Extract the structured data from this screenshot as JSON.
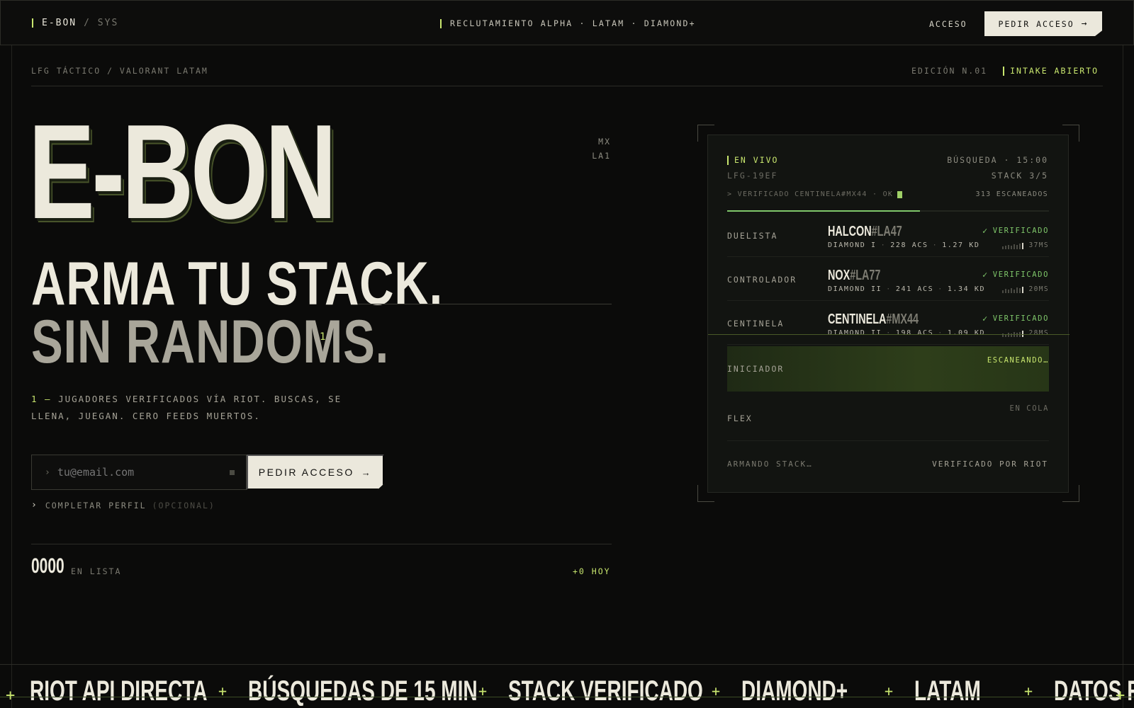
{
  "nav": {
    "brand": "E-BON",
    "brand_suffix": "/ SYS",
    "center": "RECLUTAMIENTO ALPHA · LATAM · DIAMOND+",
    "login": "ACCESO",
    "cta": "PEDIR ACCESO"
  },
  "subheader": {
    "left": "LFG TÁCTICO / VALORANT LATAM",
    "edition": "EDICIÓN N.01",
    "status": "INTAKE ABIERTO"
  },
  "hero": {
    "title": "E-BON",
    "regions": [
      "MX",
      "LA1"
    ],
    "headline_1": "ARMA TU STACK.",
    "headline_2": "SIN RANDOMS.",
    "footnote_mark": "1",
    "desc_prefix": "1 —",
    "desc": "JUGADORES VERIFICADOS VÍA RIOT. BUSCAS, SE LLENA, JUEGAN. CERO FEEDS MUERTOS."
  },
  "form": {
    "email_placeholder": "tu@email.com",
    "submit": "PEDIR ACCESO",
    "complete_profile": "COMPLETAR PERFIL",
    "optional": "(OPCIONAL)"
  },
  "stats": {
    "count": "0000",
    "count_label": "EN LISTA",
    "today": "+0 HOY"
  },
  "panel": {
    "live": "EN VIVO",
    "search": "BÚSQUEDA · 15:00",
    "id": "LFG-19EF",
    "stack": "STACK 3/5",
    "log": "> VERIFICADO CENTINELA#MX44 · OK",
    "scanned": "313 ESCANEADOS",
    "progress": 0.6,
    "slots": [
      {
        "role": "DUELISTA",
        "name": "HALCON",
        "tag": "#LA47",
        "rank": "DIAMOND I",
        "acs": "228 ACS",
        "kd": "1.27 KD",
        "status": "VERIFICADO",
        "ping": "37MS"
      },
      {
        "role": "CONTROLADOR",
        "name": "NOX",
        "tag": "#LA77",
        "rank": "DIAMOND II",
        "acs": "241 ACS",
        "kd": "1.34 KD",
        "status": "VERIFICADO",
        "ping": "20MS"
      },
      {
        "role": "CENTINELA",
        "name": "CENTINELA",
        "tag": "#MX44",
        "rank": "DIAMOND II",
        "acs": "198 ACS",
        "kd": "1.09 KD",
        "status": "VERIFICADO",
        "ping": "28MS"
      },
      {
        "role": "INICIADOR",
        "status": "ESCANEANDO…"
      },
      {
        "role": "FLEX",
        "status": "EN COLA"
      }
    ],
    "footer_left": "ARMANDO STACK…",
    "footer_right": "VERIFICADO POR RIOT"
  },
  "ticker": [
    "RIOT API DIRECTA",
    "BÚSQUEDAS DE 15 MIN",
    "STACK VERIFICADO",
    "DIAMOND+",
    "LATAM",
    "DATOS REALES",
    "RIOT API DIRECTA"
  ],
  "colors": {
    "accent": "#c8e66e",
    "verified": "#7fc76a",
    "background": "#0b0b0a",
    "cream": "#ebe8dc"
  }
}
